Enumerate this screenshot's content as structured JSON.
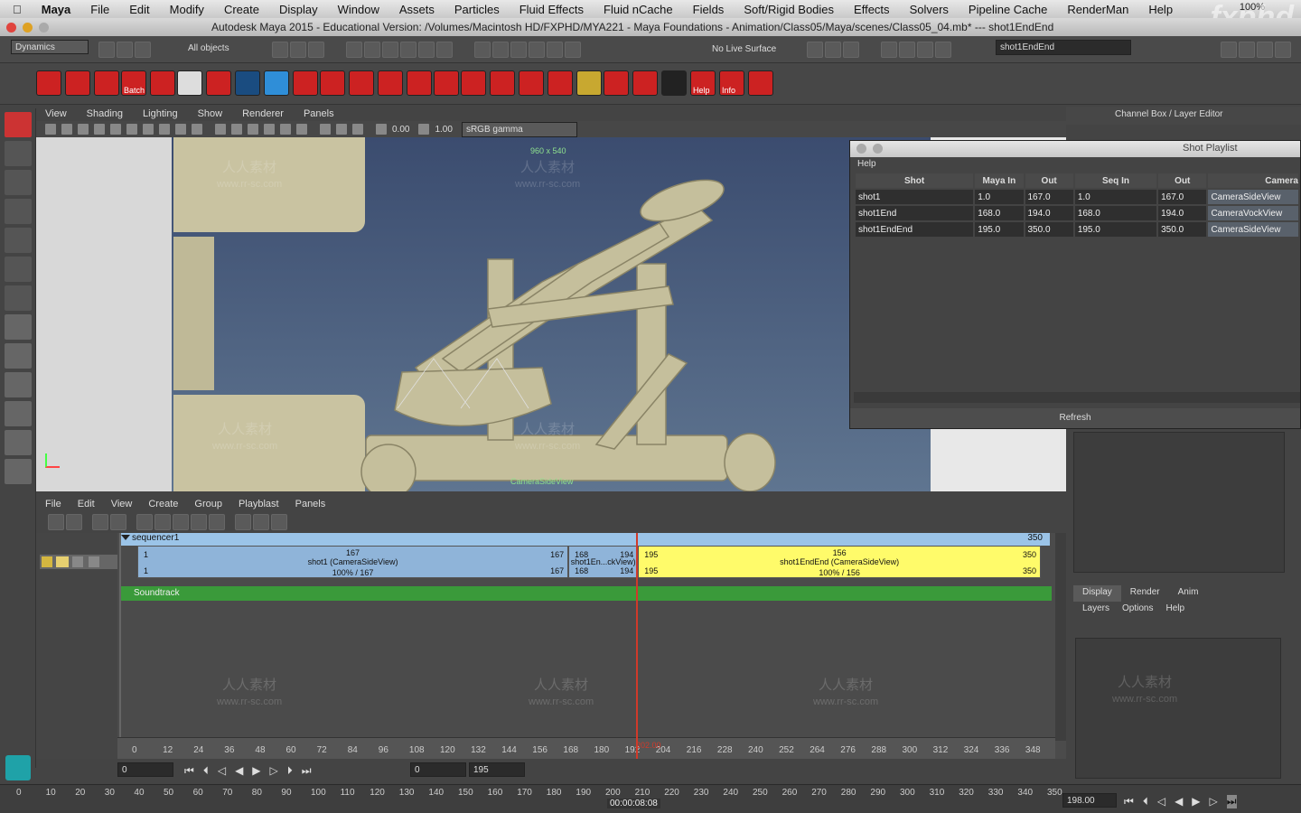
{
  "mac_menu": {
    "app": "Maya",
    "items": [
      "File",
      "Edit",
      "Modify",
      "Create",
      "Display",
      "Window",
      "Assets",
      "Particles",
      "Fluid Effects",
      "Fluid nCache",
      "Fields",
      "Soft/Rigid Bodies",
      "Effects",
      "Solvers",
      "Pipeline Cache",
      "RenderMan",
      "Help"
    ],
    "battery": "100%"
  },
  "window": {
    "title": "Autodesk Maya 2015 - Educational Version: /Volumes/Macintosh HD/FXPHD/MYA221 - Maya Foundations - Animation/Class05/Maya/scenes/Class05_04.mb*   ---   shot1EndEnd"
  },
  "status_line": {
    "menu_set": "Dynamics",
    "selection_mask": "All objects",
    "live_surface": "No Live Surface",
    "name_field": "shot1EndEnd"
  },
  "shelf": {
    "batch_label": "Batch",
    "help_label": "Help",
    "info_label": "Info"
  },
  "viewport": {
    "menu": [
      "View",
      "Shading",
      "Lighting",
      "Show",
      "Renderer",
      "Panels"
    ],
    "exposure": "0.00",
    "gamma": "1.00",
    "color_space": "sRGB gamma",
    "resolution_gate": "960 x 540",
    "camera_label": "CameraSideView"
  },
  "channel_box": {
    "title": "Channel Box / Layer Editor"
  },
  "shot_playlist": {
    "title": "Shot Playlist",
    "menu": "Help",
    "columns": [
      "Shot",
      "Maya In",
      "Out",
      "Seq In",
      "Out",
      "Camera"
    ],
    "rows": [
      [
        "shot1",
        "1.0",
        "167.0",
        "1.0",
        "167.0",
        "CameraSideView"
      ],
      [
        "shot1End",
        "168.0",
        "194.0",
        "168.0",
        "194.0",
        "CameraVockView"
      ],
      [
        "shot1EndEnd",
        "195.0",
        "350.0",
        "195.0",
        "350.0",
        "CameraSideView"
      ]
    ],
    "refresh_label": "Refresh"
  },
  "sequencer": {
    "menu": [
      "File",
      "Edit",
      "View",
      "Create",
      "Group",
      "Playblast",
      "Panels"
    ],
    "track_name": "sequencer1",
    "track_end": "350",
    "shots": [
      {
        "start_top": "1",
        "start_bottom": "1",
        "label": "shot1 (CameraSideView)",
        "mid_top": "167",
        "mid_bottom": "100%   /   167",
        "end_top": "167",
        "end_bottom": "167",
        "color": "#8fb4d9",
        "start": 1,
        "end": 167
      },
      {
        "start_top": "168",
        "start_bottom": "168",
        "label": "shot1En...ckView)",
        "end_top": "194",
        "end_bottom": "194",
        "color": "#8fb4d9",
        "start": 168,
        "end": 194
      },
      {
        "start_top": "195",
        "start_bottom": "195",
        "label": "shot1EndEnd (CameraSideView)",
        "mid_top": "156",
        "mid_bottom": "100%   /   156",
        "end_top": "350",
        "end_bottom": "350",
        "color": "#fffb6a",
        "start": 195,
        "end": 350
      }
    ],
    "soundtrack": "Soundtrack",
    "ruler": [
      "0",
      "12",
      "24",
      "36",
      "48",
      "60",
      "72",
      "84",
      "96",
      "108",
      "120",
      "132",
      "144",
      "156",
      "168",
      "180",
      "192",
      "204",
      "216",
      "228",
      "240",
      "252",
      "264",
      "276",
      "288",
      "300",
      "312",
      "324",
      "336",
      "348"
    ],
    "start_field": "0",
    "current_field": "0",
    "end_field": "195",
    "current_frame_label": "202.00"
  },
  "layer_editor": {
    "tabs": [
      "Display",
      "Render",
      "Anim"
    ],
    "menu": [
      "Layers",
      "Options",
      "Help"
    ]
  },
  "time_slider": {
    "ticks": [
      "0",
      "10",
      "20",
      "30",
      "40",
      "50",
      "60",
      "70",
      "80",
      "90",
      "100",
      "110",
      "120",
      "130",
      "140",
      "150",
      "160",
      "170",
      "180",
      "190",
      "200",
      "210",
      "220",
      "230",
      "240",
      "250",
      "260",
      "270",
      "280",
      "290",
      "300",
      "310",
      "320",
      "330",
      "340",
      "350"
    ],
    "timecode": "00:00:08:08",
    "current_time": "198.00"
  },
  "watermarks": {
    "cn": "人人素材",
    "url": "www.rr-sc.com",
    "brand": "fxphd"
  },
  "colors": {
    "shot_blue": "#8fb4d9",
    "shot_yellow": "#fffb6a",
    "soundtrack_green": "#3a9a3a",
    "playhead": "#d03a2a"
  }
}
